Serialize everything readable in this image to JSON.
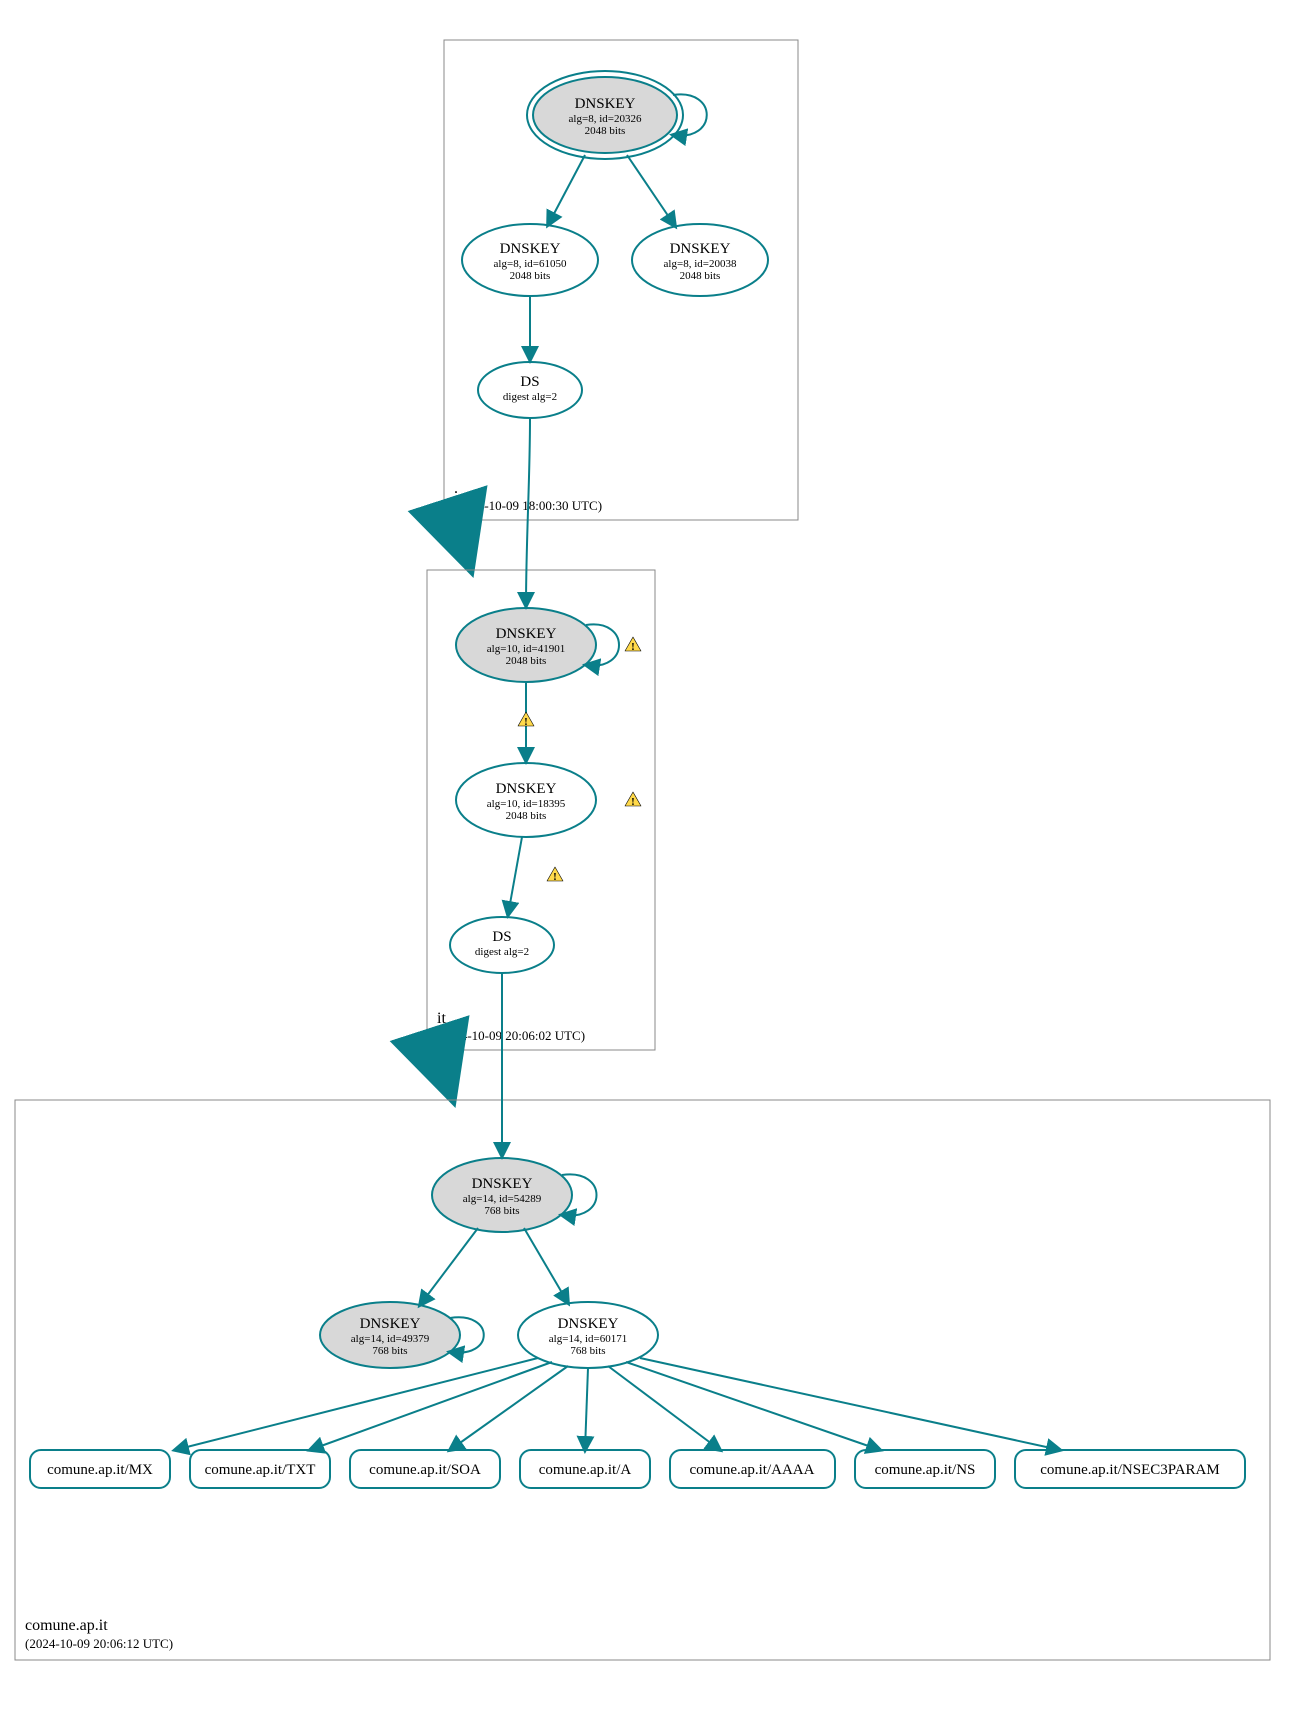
{
  "zones": {
    "root": {
      "label": ".",
      "time": "(2024-10-09 18:00:30 UTC)"
    },
    "it": {
      "label": "it",
      "time": "(2024-10-09 20:06:02 UTC)"
    },
    "comune": {
      "label": "comune.ap.it",
      "time": "(2024-10-09 20:06:12 UTC)"
    }
  },
  "nodes": {
    "root_ksk": {
      "title": "DNSKEY",
      "l1": "alg=8, id=20326",
      "l2": "2048 bits"
    },
    "root_zsk": {
      "title": "DNSKEY",
      "l1": "alg=8, id=61050",
      "l2": "2048 bits"
    },
    "root_zsk2": {
      "title": "DNSKEY",
      "l1": "alg=8, id=20038",
      "l2": "2048 bits"
    },
    "root_ds": {
      "title": "DS",
      "l1": "digest alg=2"
    },
    "it_ksk": {
      "title": "DNSKEY",
      "l1": "alg=10, id=41901",
      "l2": "2048 bits"
    },
    "it_zsk": {
      "title": "DNSKEY",
      "l1": "alg=10, id=18395",
      "l2": "2048 bits"
    },
    "it_ds": {
      "title": "DS",
      "l1": "digest alg=2"
    },
    "com_ksk": {
      "title": "DNSKEY",
      "l1": "alg=14, id=54289",
      "l2": "768 bits"
    },
    "com_zsk_old": {
      "title": "DNSKEY",
      "l1": "alg=14, id=49379",
      "l2": "768 bits"
    },
    "com_zsk": {
      "title": "DNSKEY",
      "l1": "alg=14, id=60171",
      "l2": "768 bits"
    }
  },
  "rrsets": {
    "mx": "comune.ap.it/MX",
    "txt": "comune.ap.it/TXT",
    "soa": "comune.ap.it/SOA",
    "a": "comune.ap.it/A",
    "aaaa": "comune.ap.it/AAAA",
    "ns": "comune.ap.it/NS",
    "nsec": "comune.ap.it/NSEC3PARAM"
  }
}
